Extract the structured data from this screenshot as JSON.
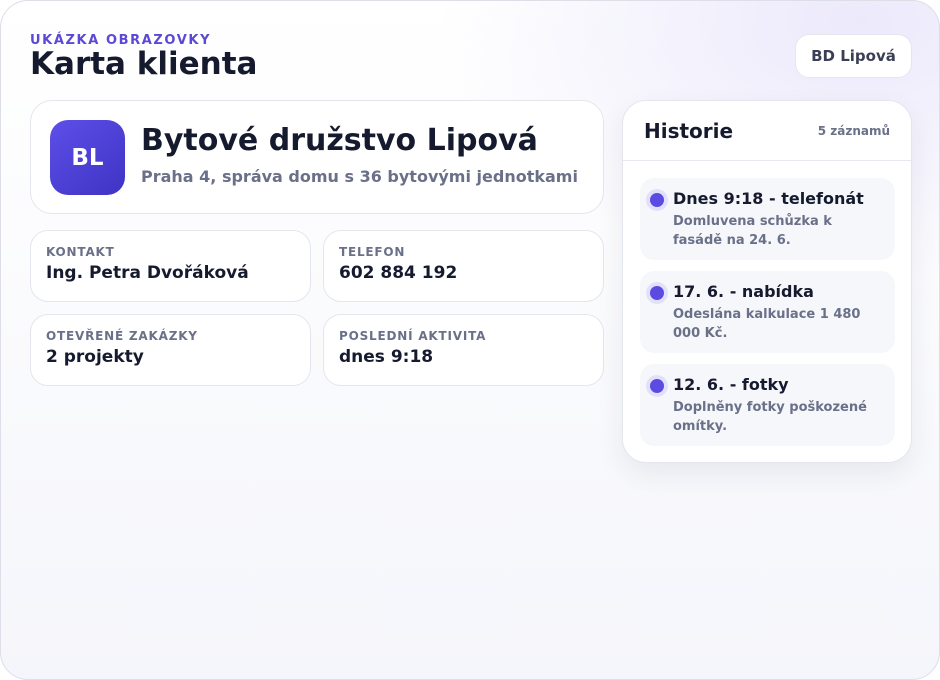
{
  "header": {
    "eyebrow": "UKÁZKA OBRAZOVKY",
    "title": "Karta klienta",
    "chip": "BD Lipová"
  },
  "client": {
    "initials": "BL",
    "name": "Bytové družstvo Lipová",
    "subtitle": "Praha 4, správa domu s 36 bytovými jednotkami"
  },
  "info": [
    {
      "label": "KONTAKT",
      "value": "Ing. Petra Dvořáková"
    },
    {
      "label": "TELEFON",
      "value": "602 884 192"
    },
    {
      "label": "OTEVŘENÉ ZAKÁZKY",
      "value": "2 projekty"
    },
    {
      "label": "POSLEDNÍ AKTIVITA",
      "value": "dnes 9:18"
    }
  ],
  "history": {
    "title": "Historie",
    "count": "5 záznamů",
    "entries": [
      {
        "title": "Dnes 9:18 - telefonát",
        "text": "Domluvena schůzka k fasádě na 24. 6."
      },
      {
        "title": "17. 6. - nabídka",
        "text": "Odeslána kalkulace 1 480 000 Kč."
      },
      {
        "title": "12. 6. - fotky",
        "text": "Doplněny fotky poškozené omítky."
      }
    ]
  },
  "colors": {
    "accent": "#5b48d6",
    "avatar": "#4f42d8",
    "text": "#161a2e",
    "muted": "#6b7089"
  }
}
